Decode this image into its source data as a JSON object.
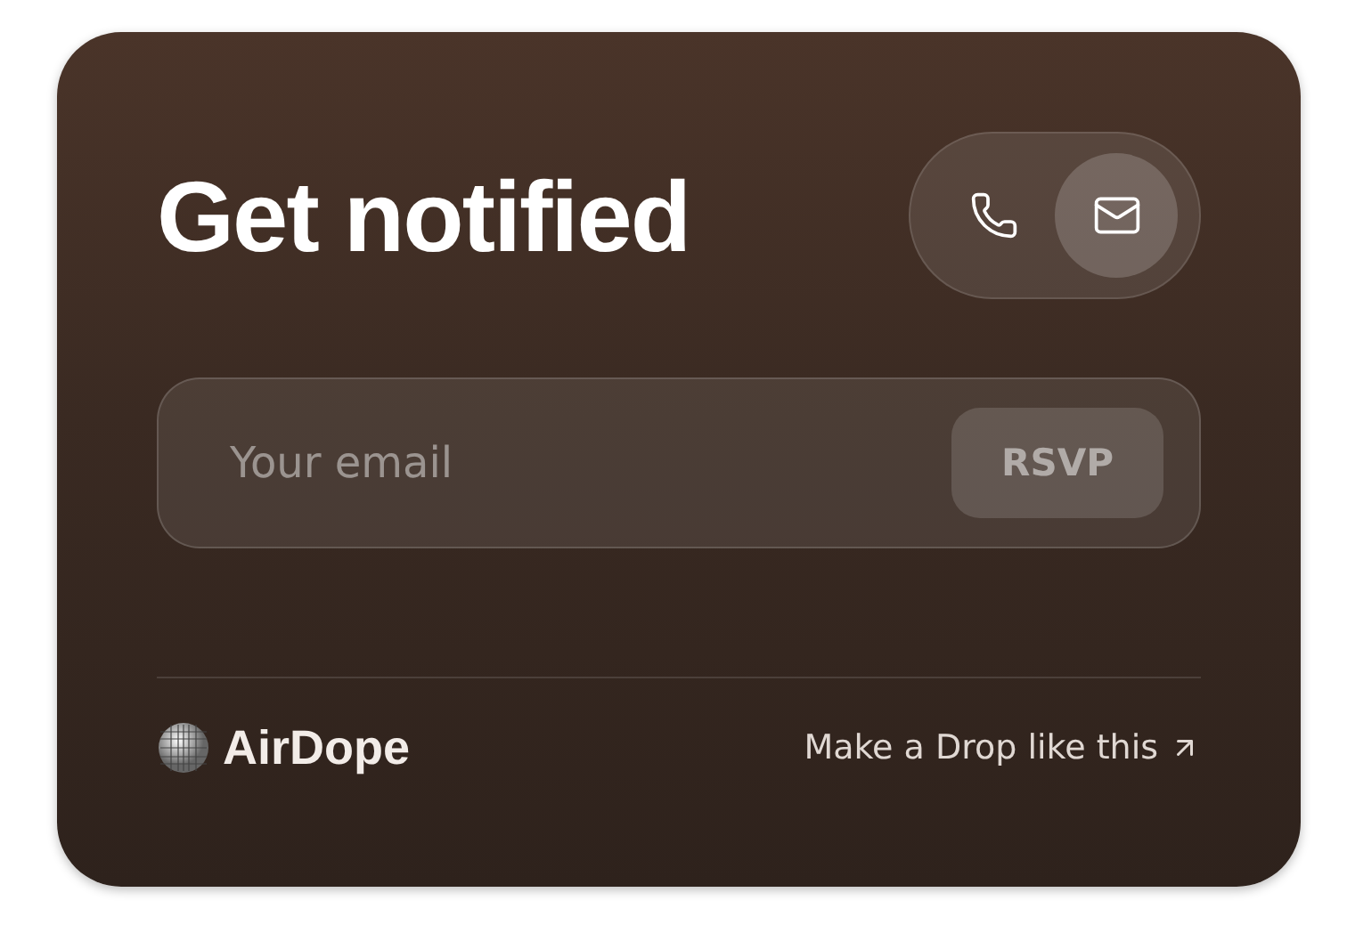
{
  "title": "Get notified",
  "channels": [
    {
      "kind": "phone",
      "selected": false
    },
    {
      "kind": "email",
      "selected": true
    }
  ],
  "email_field": {
    "placeholder": "Your email"
  },
  "submit_button": {
    "label": "RSVP"
  },
  "footer": {
    "brand": "AirDope",
    "link": "Make a Drop like this"
  }
}
